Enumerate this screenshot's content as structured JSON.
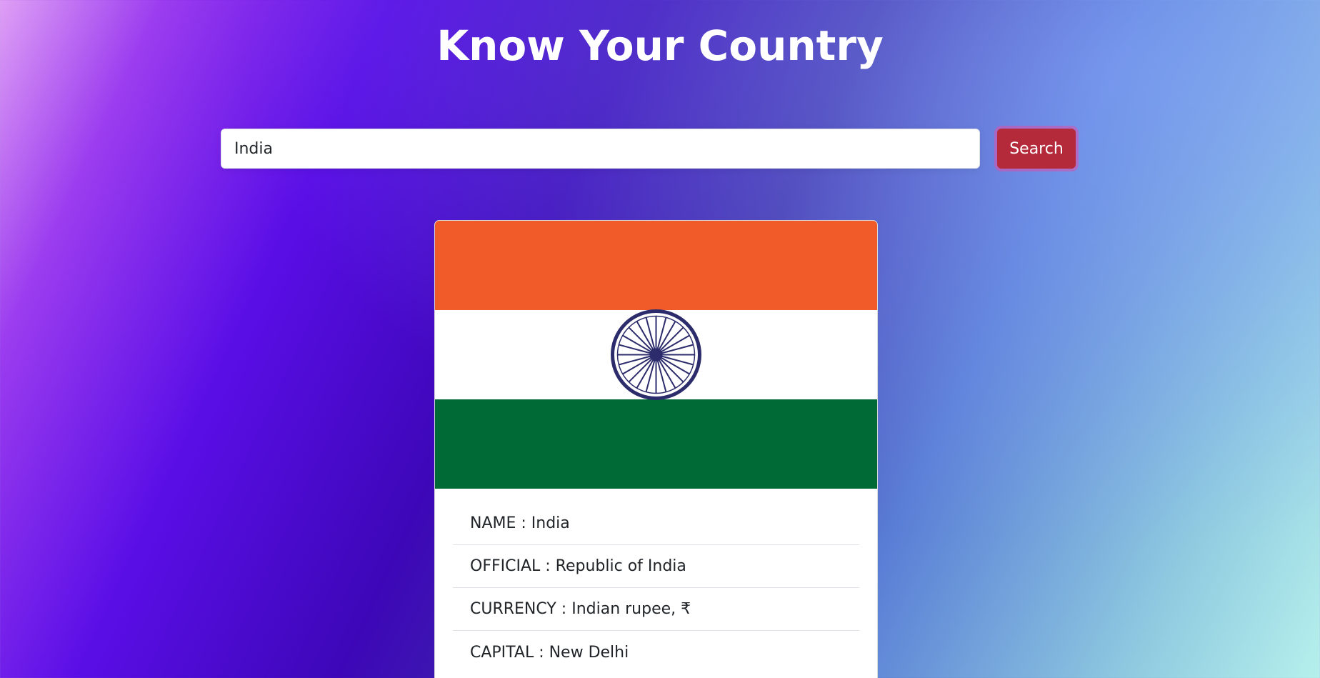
{
  "page": {
    "title": "Know Your Country"
  },
  "search": {
    "value": "India",
    "button_label": "Search"
  },
  "country": {
    "flag": {
      "colors": {
        "saffron": "#f15b29",
        "white": "#ffffff",
        "green": "#006a37",
        "chakra": "#2c2c6c"
      },
      "icon": "india-flag"
    },
    "details": [
      {
        "label": "NAME",
        "separator": " : ",
        "value": "India",
        "text": "NAME : India"
      },
      {
        "label": "OFFICIAL",
        "separator": " : ",
        "value": "Republic of India",
        "text": "OFFICIAL : Republic of India"
      },
      {
        "label": "CURRENCY",
        "separator": " : ",
        "value": "Indian rupee, ₹",
        "text": "CURRENCY : Indian rupee, ₹"
      },
      {
        "label": "CAPITAL",
        "separator": " : ",
        "value": "New Delhi",
        "text": "CAPITAL : New Delhi"
      }
    ]
  },
  "colors": {
    "button_bg": "#b52a3a",
    "title_color": "#ffffff"
  }
}
